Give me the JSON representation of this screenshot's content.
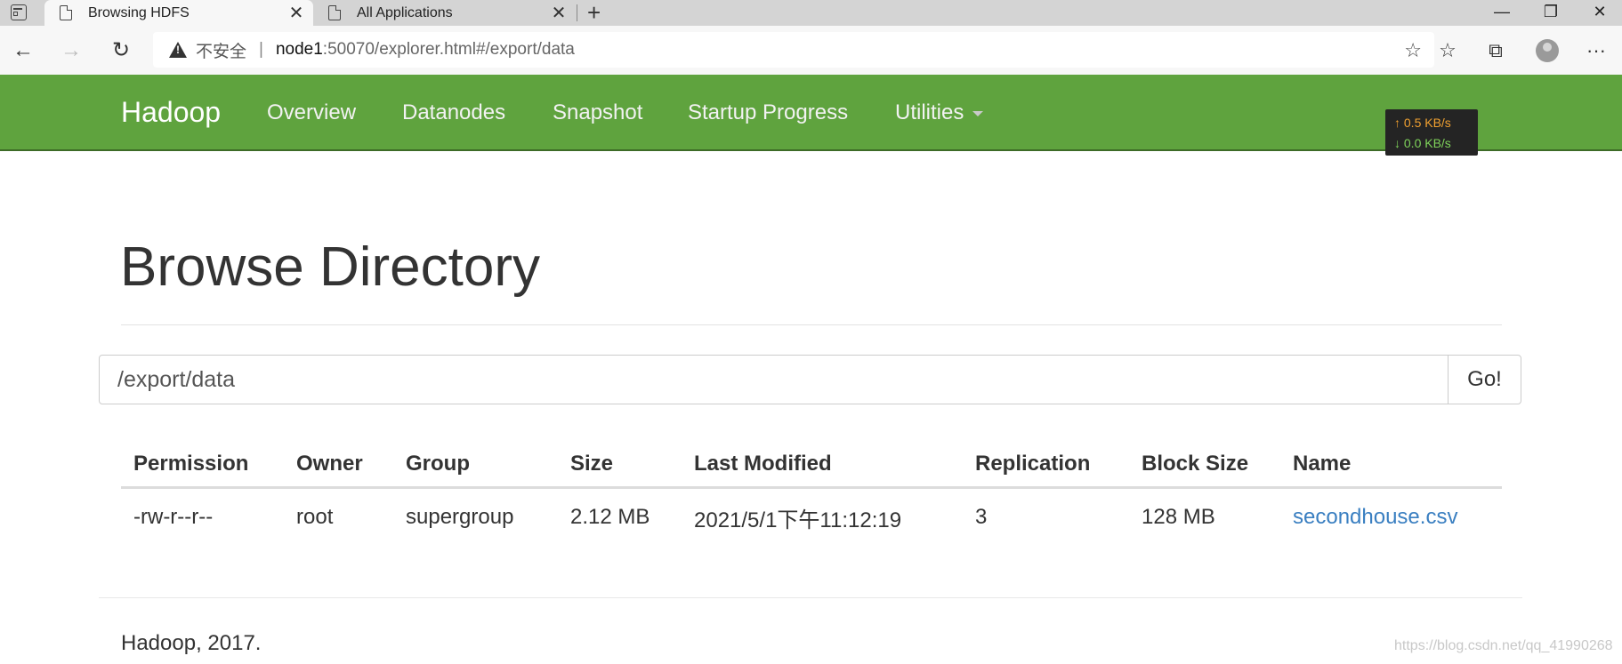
{
  "browser": {
    "tabs": [
      {
        "label": "Browsing HDFS",
        "active": true
      },
      {
        "label": "All Applications",
        "active": false
      }
    ],
    "new_tab_glyph": "+",
    "window_controls": {
      "minimize": "—",
      "restore": "❐",
      "close": "✕"
    },
    "address": {
      "security_label": "不安全",
      "separator": "|",
      "host": "node1",
      "rest": ":50070/explorer.html#/export/data"
    },
    "toolbar_glyphs": {
      "back": "←",
      "forward": "→",
      "reload": "↻",
      "favorite_add": "☆",
      "favorites": "☆",
      "collections": "⧉",
      "more": "···"
    }
  },
  "navbar": {
    "brand": "Hadoop",
    "items": [
      "Overview",
      "Datanodes",
      "Snapshot",
      "Startup Progress",
      "Utilities"
    ],
    "accent_color": "#5fa33e"
  },
  "speed_overlay": {
    "up": "↑ 0.5 KB/s",
    "down": "↓ 0.0 KB/s"
  },
  "page": {
    "title": "Browse Directory",
    "path_value": "/export/data",
    "go_label": "Go!",
    "table": {
      "headers": [
        "Permission",
        "Owner",
        "Group",
        "Size",
        "Last Modified",
        "Replication",
        "Block Size",
        "Name"
      ],
      "rows": [
        [
          "-rw-r--r--",
          "root",
          "supergroup",
          "2.12 MB",
          "2021/5/1下午11:12:19",
          "3",
          "128 MB",
          "secondhouse.csv"
        ]
      ]
    },
    "footer": "Hadoop, 2017.",
    "watermark": "https://blog.csdn.net/qq_41990268"
  }
}
